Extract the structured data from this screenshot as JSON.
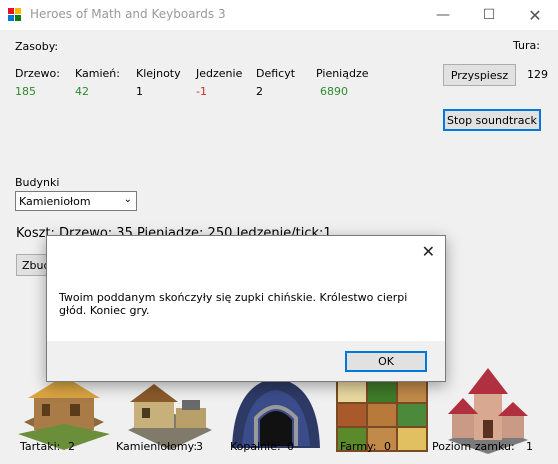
{
  "window": {
    "title": "Heroes of Math and Keyboards 3"
  },
  "resources": {
    "heading": "Zasoby:",
    "items": [
      {
        "label": "Drzewo:",
        "value": "185"
      },
      {
        "label": "Kamień:",
        "value": "42"
      },
      {
        "label": "Klejnoty",
        "value": "1"
      },
      {
        "label": "Jedzenie",
        "value": "-1"
      },
      {
        "label": "Deficyt",
        "value": "2"
      },
      {
        "label": "Pieniądze",
        "value": "6890"
      }
    ]
  },
  "turn": {
    "label": "Tura:",
    "value": "129",
    "speed_button": "Przyspiesz"
  },
  "sound": {
    "stop_button": "Stop soundtrack"
  },
  "buildings": {
    "label": "Budynki",
    "selected": "Kamieniołom",
    "cost_text": "Koszt: Drzewo: 35   Pieniadze: 250    Jedzenie/tick:1",
    "build_button": "Zbud"
  },
  "dialog": {
    "message": "Twoim poddanym skończyły się zupki chińskie. Królestwo cierpi głód. Koniec gry.",
    "ok_button": "OK"
  },
  "stats": [
    {
      "label": "Tartaki:",
      "value": "2"
    },
    {
      "label": "Kamieniołomy:",
      "value": "3"
    },
    {
      "label": "Kopalnie:",
      "value": "0"
    },
    {
      "label": "Farmy:",
      "value": "0"
    },
    {
      "label": "Poziom zamku:",
      "value": "1"
    }
  ],
  "images": [
    "sawmill-image",
    "quarry-image",
    "mine-image",
    "farm-image",
    "castle-image"
  ]
}
